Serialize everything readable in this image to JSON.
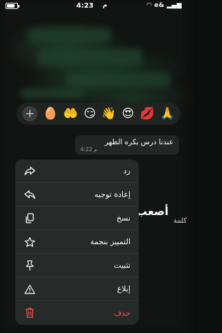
{
  "status": {
    "time": "4:23",
    "period": "م",
    "carrier": "e&"
  },
  "reactions": [
    "🥚",
    "🤲",
    "😏",
    "👋",
    "😍",
    "💋",
    "🙏"
  ],
  "message": {
    "text": "عندنا درس بكره الظهر",
    "time": "4:22 م"
  },
  "background_text": {
    "big": "أصعب",
    "side": "كلمة"
  },
  "menu": {
    "reply": "رد",
    "forward": "إعادة توجيه",
    "copy": "نسخ",
    "star": "التمييز بنجمة",
    "pin": "تثبيت",
    "report": "إبلاغ",
    "delete": "حذف"
  },
  "colors": {
    "danger": "#ff4d4d",
    "menu_bg": "#262a28"
  }
}
